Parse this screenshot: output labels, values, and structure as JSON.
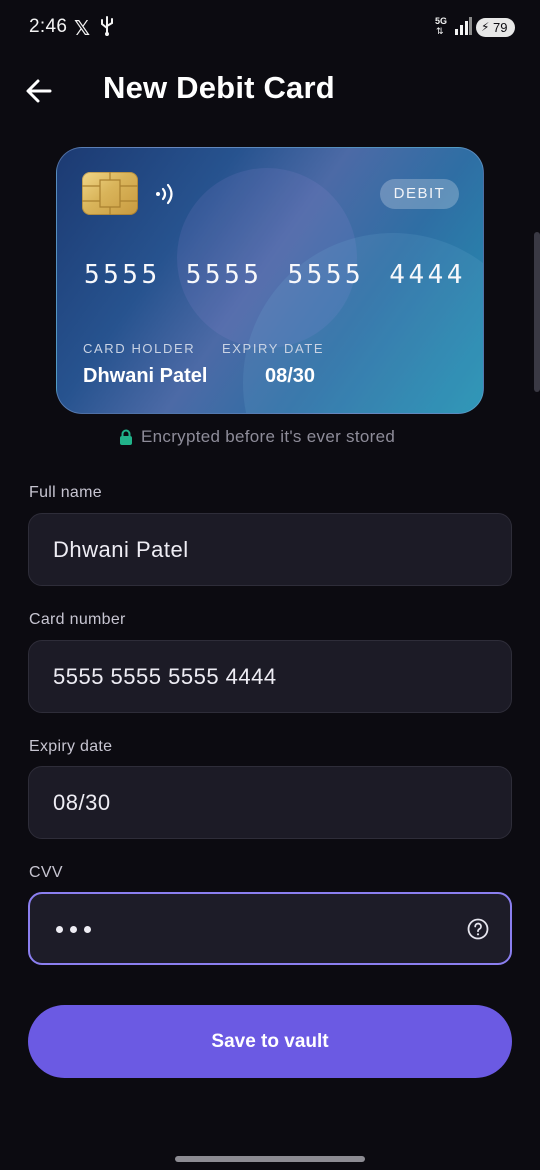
{
  "status_bar": {
    "time": "2:46",
    "x_logo": "𝕏",
    "network_type": "5G",
    "battery_percent": "79",
    "icons": [
      "x-logo-icon",
      "usb-icon",
      "network-5g-icon",
      "signal-icon",
      "battery-charging-icon"
    ]
  },
  "header": {
    "back_icon": "arrow-left-icon",
    "title": "New Debit Card"
  },
  "card": {
    "badge": "DEBIT",
    "number": "5555 5555 5555 4444",
    "holder_label": "CARD HOLDER",
    "holder_name": "Dhwani Patel",
    "expiry_label": "EXPIRY DATE",
    "expiry": "08/30",
    "icons": [
      "chip-icon",
      "contactless-icon"
    ]
  },
  "security_note": {
    "icon": "lock-icon",
    "text": "Encrypted before it's ever stored",
    "color": "#21b38a"
  },
  "form": {
    "full_name": {
      "label": "Full name",
      "value": "Dhwani Patel"
    },
    "card_number": {
      "label": "Card number",
      "value": "5555 5555 5555 4444"
    },
    "expiry_date": {
      "label": "Expiry date",
      "value": "08/30"
    },
    "cvv": {
      "label": "CVV",
      "masked_length": 3,
      "help_icon": "question-circle-icon"
    }
  },
  "actions": {
    "save_label": "Save to vault",
    "accent_color": "#6b5ae3"
  }
}
